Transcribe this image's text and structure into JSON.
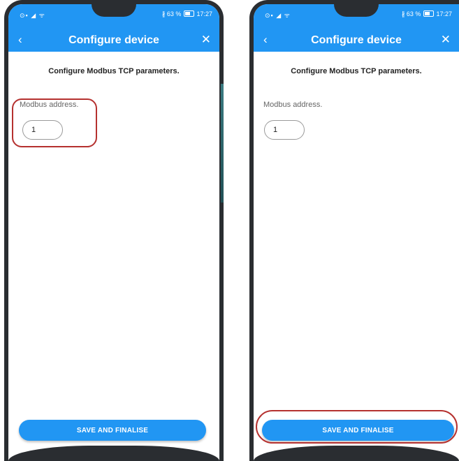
{
  "screens": [
    {
      "status": {
        "left": "⊙▪ ◢ ᯤ",
        "bt": "∦",
        "battery": "63 %",
        "time": "17:27"
      },
      "appbar": {
        "back": "‹",
        "title": "Configure device",
        "close": "✕"
      },
      "subtitle": "Configure Modbus TCP parameters.",
      "field": {
        "label": "Modbus address.",
        "value": "1"
      },
      "button": "SAVE AND FINALISE",
      "highlighted": "field"
    },
    {
      "status": {
        "left": "⊙▪ ◢ ᯤ",
        "bt": "∦",
        "battery": "63 %",
        "time": "17:27"
      },
      "appbar": {
        "back": "‹",
        "title": "Configure device",
        "close": "✕"
      },
      "subtitle": "Configure Modbus TCP parameters.",
      "field": {
        "label": "Modbus address.",
        "value": "1"
      },
      "button": "SAVE AND FINALISE",
      "highlighted": "button"
    }
  ],
  "colors": {
    "primary": "#2196f3",
    "highlight": "#b5312f",
    "bezel": "#2a2d31"
  },
  "icons": {
    "back": "chevron-left-icon",
    "close": "close-icon",
    "battery": "battery-icon",
    "signal": "signal-icon",
    "bluetooth": "bluetooth-icon"
  }
}
